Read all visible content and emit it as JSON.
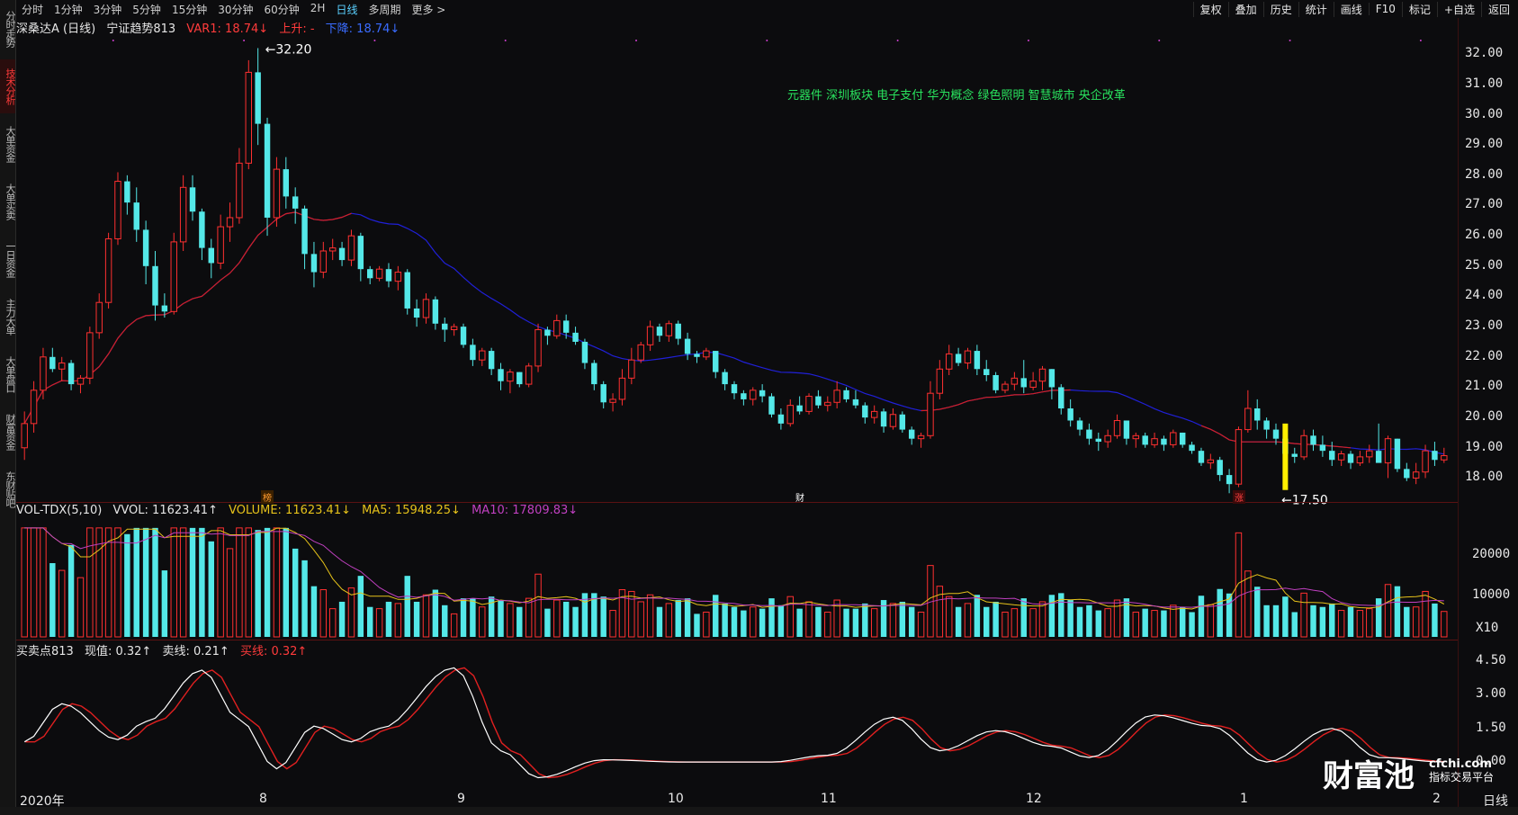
{
  "left_tabs": [
    {
      "label": "分时走势",
      "active": false
    },
    {
      "label": "技术分析",
      "active": true
    },
    {
      "label": "大单资金",
      "active": false
    },
    {
      "label": "大单买卖",
      "active": false
    },
    {
      "label": "一日资金",
      "active": false
    },
    {
      "label": "主力大单",
      "active": false
    },
    {
      "label": "大单盘口",
      "active": false
    },
    {
      "label": "财富资金",
      "active": false
    },
    {
      "label": "东财贴吧",
      "active": false
    }
  ],
  "periods": [
    "分时",
    "1分钟",
    "3分钟",
    "5分钟",
    "15分钟",
    "30分钟",
    "60分钟",
    "2H",
    "日线",
    "多周期",
    "更多 >"
  ],
  "active_period": "日线",
  "tools": [
    "复权",
    "叠加",
    "历史",
    "统计",
    "画线",
    "F10",
    "标记",
    "+自选",
    "返回"
  ],
  "main_legend": {
    "title": "深桑达A (日线)",
    "indicator": "宁证趋势813",
    "var1": "VAR1: 18.74↓",
    "up": "上升: -",
    "down": "下降: 18.74↓"
  },
  "concepts": "元器件  深圳板块  电子支付 华为概念 绿色照明 智慧城市 央企改革",
  "high_label": "32.20",
  "low_label": "17.50",
  "price_axis": [
    "32.00",
    "31.00",
    "30.00",
    "29.00",
    "28.00",
    "27.00",
    "26.00",
    "25.00",
    "24.00",
    "23.00",
    "22.00",
    "21.00",
    "20.00",
    "19.00",
    "18.00"
  ],
  "markers": [
    {
      "text": "榜",
      "color": "#ff9a2e"
    },
    {
      "text": "财",
      "color": "#ffffff"
    },
    {
      "text": "涨",
      "color": "#ff4040"
    }
  ],
  "vol_legend": {
    "name": "VOL-TDX(5,10)",
    "vvol": "VVOL: 11623.41↑",
    "volume": "VOLUME: 11623.41↓",
    "ma5": "MA5: 15948.25↓",
    "ma10": "MA10: 17809.83↓"
  },
  "vol_axis": [
    "20000",
    "10000",
    "X10"
  ],
  "osc_legend": {
    "name": "买卖点813",
    "now": "现值: 0.32↑",
    "sell": "卖线: 0.21↑",
    "buy": "买线: 0.32↑"
  },
  "osc_axis": [
    "4.50",
    "3.00",
    "1.50",
    "0.00"
  ],
  "x_labels": [
    "2020年",
    "8",
    "9",
    "10",
    "11",
    "12",
    "1",
    "2"
  ],
  "corner_label": "日线",
  "watermark": {
    "brand": "财富池",
    "site": "cfchi.com",
    "slogan": "指标交易平台"
  },
  "colors": {
    "up": "#ff3030",
    "down": "#54e8e8",
    "ma_red": "#d42020",
    "ma_blue": "#2020d8",
    "ma5": "#e6c21a",
    "ma10": "#c040c0",
    "osc_white": "#ffffff",
    "osc_red": "#e02020",
    "highlight": "#ffee00"
  },
  "chart_data": {
    "type": "candlestick",
    "ohlc": [
      [
        19.0,
        20.2,
        18.6,
        19.8
      ],
      [
        19.8,
        21.2,
        19.5,
        20.9
      ],
      [
        20.9,
        22.3,
        20.6,
        22.0
      ],
      [
        22.0,
        22.3,
        21.5,
        21.6
      ],
      [
        21.6,
        22.0,
        21.2,
        21.8
      ],
      [
        21.8,
        21.9,
        20.9,
        21.1
      ],
      [
        21.1,
        21.4,
        20.8,
        21.3
      ],
      [
        21.3,
        23.0,
        21.1,
        22.8
      ],
      [
        22.8,
        24.1,
        22.6,
        23.8
      ],
      [
        23.8,
        26.1,
        23.6,
        25.9
      ],
      [
        25.9,
        28.1,
        25.7,
        27.8
      ],
      [
        27.8,
        28.0,
        26.7,
        27.1
      ],
      [
        27.1,
        27.6,
        25.8,
        26.2
      ],
      [
        26.2,
        26.5,
        24.4,
        25.0
      ],
      [
        25.0,
        25.5,
        23.2,
        23.7
      ],
      [
        23.7,
        24.1,
        23.3,
        23.5
      ],
      [
        23.5,
        26.1,
        23.4,
        25.8
      ],
      [
        25.8,
        28.0,
        25.5,
        27.6
      ],
      [
        27.6,
        28.0,
        26.5,
        26.8
      ],
      [
        26.8,
        26.9,
        25.2,
        25.6
      ],
      [
        25.6,
        25.9,
        24.6,
        25.1
      ],
      [
        25.1,
        26.7,
        24.9,
        26.3
      ],
      [
        26.3,
        27.1,
        25.8,
        26.6
      ],
      [
        26.6,
        28.9,
        26.4,
        28.4
      ],
      [
        28.4,
        31.8,
        28.2,
        31.4
      ],
      [
        31.4,
        32.2,
        29.0,
        29.7
      ],
      [
        29.7,
        29.9,
        26.0,
        26.6
      ],
      [
        26.6,
        28.6,
        26.3,
        28.2
      ],
      [
        28.2,
        28.6,
        26.9,
        27.3
      ],
      [
        27.3,
        27.6,
        26.4,
        26.9
      ],
      [
        26.9,
        27.0,
        24.9,
        25.4
      ],
      [
        25.4,
        25.8,
        24.3,
        24.8
      ],
      [
        24.8,
        25.8,
        24.6,
        25.5
      ],
      [
        25.5,
        25.9,
        25.2,
        25.6
      ],
      [
        25.6,
        25.8,
        25.0,
        25.2
      ],
      [
        25.2,
        26.2,
        25.0,
        26.0
      ],
      [
        26.0,
        26.1,
        24.5,
        24.9
      ],
      [
        24.9,
        25.0,
        24.4,
        24.6
      ],
      [
        24.6,
        25.0,
        24.5,
        24.9
      ],
      [
        24.9,
        25.1,
        24.3,
        24.5
      ],
      [
        24.5,
        25.0,
        24.2,
        24.8
      ],
      [
        24.8,
        24.9,
        23.4,
        23.6
      ],
      [
        23.6,
        23.9,
        23.0,
        23.3
      ],
      [
        23.3,
        24.1,
        23.1,
        23.9
      ],
      [
        23.9,
        24.0,
        22.9,
        23.1
      ],
      [
        23.1,
        23.3,
        22.5,
        22.9
      ],
      [
        22.9,
        23.1,
        22.7,
        23.0
      ],
      [
        23.0,
        23.1,
        22.3,
        22.4
      ],
      [
        22.4,
        22.6,
        21.7,
        21.9
      ],
      [
        21.9,
        22.3,
        21.7,
        22.2
      ],
      [
        22.2,
        22.3,
        21.4,
        21.6
      ],
      [
        21.6,
        21.8,
        20.9,
        21.2
      ],
      [
        21.2,
        21.6,
        20.8,
        21.5
      ],
      [
        21.5,
        21.5,
        21.0,
        21.1
      ],
      [
        21.1,
        21.8,
        21.0,
        21.7
      ],
      [
        21.7,
        23.1,
        21.5,
        22.9
      ],
      [
        22.9,
        23.0,
        22.4,
        22.7
      ],
      [
        22.7,
        23.4,
        22.6,
        23.2
      ],
      [
        23.2,
        23.4,
        22.6,
        22.8
      ],
      [
        22.8,
        23.0,
        22.4,
        22.5
      ],
      [
        22.5,
        22.6,
        21.6,
        21.8
      ],
      [
        21.8,
        21.9,
        20.9,
        21.1
      ],
      [
        21.1,
        21.2,
        20.3,
        20.5
      ],
      [
        20.5,
        20.8,
        20.2,
        20.6
      ],
      [
        20.6,
        21.6,
        20.4,
        21.3
      ],
      [
        21.3,
        22.3,
        21.1,
        21.9
      ],
      [
        21.9,
        22.5,
        21.8,
        22.4
      ],
      [
        22.4,
        23.2,
        22.2,
        23.0
      ],
      [
        23.0,
        23.1,
        22.5,
        22.7
      ],
      [
        22.7,
        23.2,
        22.5,
        23.1
      ],
      [
        23.1,
        23.2,
        22.4,
        22.6
      ],
      [
        22.6,
        22.8,
        21.9,
        22.1
      ],
      [
        22.1,
        22.2,
        21.8,
        22.0
      ],
      [
        22.0,
        22.3,
        21.9,
        22.2
      ],
      [
        22.2,
        22.2,
        21.3,
        21.5
      ],
      [
        21.5,
        21.6,
        20.9,
        21.1
      ],
      [
        21.1,
        21.2,
        20.6,
        20.8
      ],
      [
        20.8,
        20.9,
        20.4,
        20.6
      ],
      [
        20.6,
        21.0,
        20.4,
        20.9
      ],
      [
        20.9,
        21.1,
        20.5,
        20.7
      ],
      [
        20.7,
        20.8,
        20.0,
        20.1
      ],
      [
        20.1,
        20.3,
        19.6,
        19.8
      ],
      [
        19.8,
        20.6,
        19.7,
        20.4
      ],
      [
        20.4,
        20.7,
        20.1,
        20.2
      ],
      [
        20.2,
        20.8,
        20.1,
        20.7
      ],
      [
        20.7,
        20.9,
        20.3,
        20.4
      ],
      [
        20.4,
        20.7,
        20.2,
        20.5
      ],
      [
        20.5,
        21.2,
        20.3,
        20.9
      ],
      [
        20.9,
        21.0,
        20.5,
        20.6
      ],
      [
        20.6,
        20.9,
        20.3,
        20.4
      ],
      [
        20.4,
        20.5,
        19.8,
        20.0
      ],
      [
        20.0,
        20.4,
        19.8,
        20.2
      ],
      [
        20.2,
        20.3,
        19.5,
        19.7
      ],
      [
        19.7,
        20.3,
        19.6,
        20.1
      ],
      [
        20.1,
        20.2,
        19.5,
        19.6
      ],
      [
        19.6,
        19.7,
        19.1,
        19.3
      ],
      [
        19.3,
        19.5,
        19.0,
        19.4
      ],
      [
        19.4,
        21.2,
        19.3,
        20.8
      ],
      [
        20.8,
        21.9,
        20.6,
        21.6
      ],
      [
        21.6,
        22.4,
        21.4,
        22.1
      ],
      [
        22.1,
        22.3,
        21.7,
        21.8
      ],
      [
        21.8,
        22.3,
        21.6,
        22.2
      ],
      [
        22.2,
        22.4,
        21.4,
        21.6
      ],
      [
        21.6,
        21.9,
        21.2,
        21.4
      ],
      [
        21.4,
        21.5,
        20.8,
        20.9
      ],
      [
        20.9,
        21.2,
        20.8,
        21.1
      ],
      [
        21.1,
        21.5,
        20.9,
        21.3
      ],
      [
        21.3,
        21.9,
        20.8,
        21.0
      ],
      [
        21.0,
        21.5,
        20.9,
        21.2
      ],
      [
        21.2,
        21.7,
        20.9,
        21.6
      ],
      [
        21.6,
        21.6,
        20.6,
        21.0
      ],
      [
        21.0,
        21.1,
        20.1,
        20.3
      ],
      [
        20.3,
        20.6,
        19.7,
        19.9
      ],
      [
        19.9,
        20.0,
        19.4,
        19.6
      ],
      [
        19.6,
        19.8,
        19.1,
        19.3
      ],
      [
        19.3,
        19.5,
        18.9,
        19.2
      ],
      [
        19.2,
        19.6,
        19.0,
        19.4
      ],
      [
        19.4,
        20.1,
        19.3,
        19.9
      ],
      [
        19.9,
        19.9,
        19.1,
        19.3
      ],
      [
        19.3,
        19.5,
        19.0,
        19.4
      ],
      [
        19.4,
        19.5,
        19.0,
        19.1
      ],
      [
        19.1,
        19.5,
        19.0,
        19.3
      ],
      [
        19.3,
        19.4,
        18.9,
        19.1
      ],
      [
        19.1,
        19.6,
        19.0,
        19.5
      ],
      [
        19.5,
        19.5,
        19.0,
        19.1
      ],
      [
        19.1,
        19.2,
        18.8,
        18.9
      ],
      [
        18.9,
        19.0,
        18.4,
        18.5
      ],
      [
        18.5,
        18.8,
        18.3,
        18.6
      ],
      [
        18.6,
        18.7,
        17.9,
        18.1
      ],
      [
        18.1,
        18.3,
        17.5,
        17.8
      ],
      [
        17.8,
        19.7,
        17.7,
        19.6
      ],
      [
        19.6,
        20.9,
        19.5,
        20.3
      ],
      [
        20.3,
        20.6,
        19.6,
        19.9
      ],
      [
        19.9,
        20.0,
        19.3,
        19.6
      ],
      [
        19.6,
        19.8,
        19.1,
        19.3
      ],
      [
        19.3,
        19.6,
        18.6,
        18.8
      ],
      [
        18.8,
        19.0,
        18.5,
        18.7
      ],
      [
        18.7,
        19.6,
        18.6,
        19.4
      ],
      [
        19.4,
        19.6,
        18.9,
        19.1
      ],
      [
        19.1,
        19.4,
        18.7,
        18.9
      ],
      [
        18.9,
        19.2,
        18.4,
        18.6
      ],
      [
        18.6,
        18.9,
        18.4,
        18.8
      ],
      [
        18.8,
        18.9,
        18.3,
        18.5
      ],
      [
        18.5,
        18.9,
        18.4,
        18.7
      ],
      [
        18.7,
        19.1,
        18.5,
        18.9
      ],
      [
        18.9,
        19.8,
        18.8,
        18.5
      ],
      [
        18.5,
        19.4,
        18.0,
        19.3
      ],
      [
        19.3,
        19.3,
        18.2,
        18.3
      ],
      [
        18.3,
        18.5,
        17.9,
        18.0
      ],
      [
        18.0,
        18.5,
        17.8,
        18.2
      ],
      [
        18.2,
        19.1,
        18.0,
        18.9
      ],
      [
        18.9,
        19.2,
        18.4,
        18.6
      ],
      [
        18.6,
        19.0,
        18.5,
        18.74
      ]
    ],
    "volume_ma5": [
      15948.25
    ],
    "volume_ma10": [
      17809.83
    ],
    "last_volume": 11623.41,
    "osc_last": {
      "now": 0.32,
      "sell": 0.21,
      "buy": 0.32
    },
    "ylim": [
      17.3,
      32.6
    ],
    "vol_ylim": [
      0,
      28000
    ],
    "osc_ylim": [
      -1.0,
      4.9
    ]
  }
}
